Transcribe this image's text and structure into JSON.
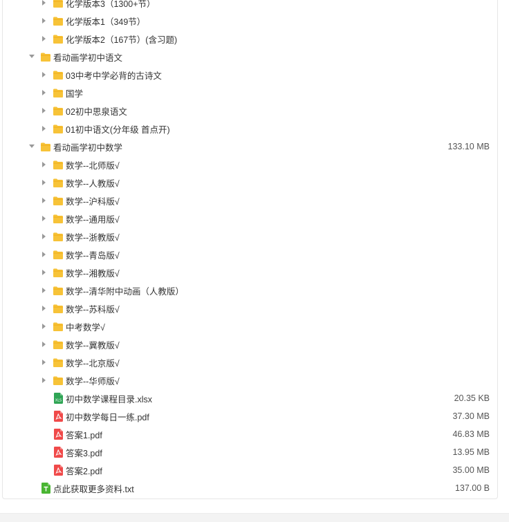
{
  "rows": [
    {
      "level": 1,
      "type": "folder",
      "state": "collapsed",
      "name": "化学版本3（1300+节）",
      "size": ""
    },
    {
      "level": 1,
      "type": "folder",
      "state": "collapsed",
      "name": "化学版本1（349节）",
      "size": ""
    },
    {
      "level": 1,
      "type": "folder",
      "state": "collapsed",
      "name": "化学版本2（167节）(含习题)",
      "size": ""
    },
    {
      "level": 0,
      "type": "folder",
      "state": "expanded",
      "name": "看动画学初中语文",
      "size": ""
    },
    {
      "level": 1,
      "type": "folder",
      "state": "collapsed",
      "name": "03中考中学必背的古诗文",
      "size": ""
    },
    {
      "level": 1,
      "type": "folder",
      "state": "collapsed",
      "name": "国学",
      "size": ""
    },
    {
      "level": 1,
      "type": "folder",
      "state": "collapsed",
      "name": "02初中思泉语文",
      "size": ""
    },
    {
      "level": 1,
      "type": "folder",
      "state": "collapsed",
      "name": "01初中语文(分年级 首点开)",
      "size": ""
    },
    {
      "level": 0,
      "type": "folder",
      "state": "expanded",
      "name": "看动画学初中数学",
      "size": "133.10 MB"
    },
    {
      "level": 1,
      "type": "folder",
      "state": "collapsed",
      "name": "数学--北师版√",
      "size": ""
    },
    {
      "level": 1,
      "type": "folder",
      "state": "collapsed",
      "name": "数学--人教版√",
      "size": ""
    },
    {
      "level": 1,
      "type": "folder",
      "state": "collapsed",
      "name": "数学--沪科版√",
      "size": ""
    },
    {
      "level": 1,
      "type": "folder",
      "state": "collapsed",
      "name": "数学--通用版√",
      "size": ""
    },
    {
      "level": 1,
      "type": "folder",
      "state": "collapsed",
      "name": "数学--浙教版√",
      "size": ""
    },
    {
      "level": 1,
      "type": "folder",
      "state": "collapsed",
      "name": "数学--青岛版√",
      "size": ""
    },
    {
      "level": 1,
      "type": "folder",
      "state": "collapsed",
      "name": "数学--湘教版√",
      "size": ""
    },
    {
      "level": 1,
      "type": "folder",
      "state": "collapsed",
      "name": "数学--清华附中动画（人教版）",
      "size": ""
    },
    {
      "level": 1,
      "type": "folder",
      "state": "collapsed",
      "name": "数学--苏科版√",
      "size": ""
    },
    {
      "level": 1,
      "type": "folder",
      "state": "collapsed",
      "name": "中考数学√",
      "size": ""
    },
    {
      "level": 1,
      "type": "folder",
      "state": "collapsed",
      "name": "数学--冀教版√",
      "size": ""
    },
    {
      "level": 1,
      "type": "folder",
      "state": "collapsed",
      "name": "数学--北京版√",
      "size": ""
    },
    {
      "level": 1,
      "type": "folder",
      "state": "collapsed",
      "name": "数学--华师版√",
      "size": ""
    },
    {
      "level": 1,
      "type": "xlsx",
      "state": "",
      "name": "初中数学课程目录.xlsx",
      "size": "20.35 KB"
    },
    {
      "level": 1,
      "type": "pdf",
      "state": "",
      "name": "初中数学每日一练.pdf",
      "size": "37.30 MB"
    },
    {
      "level": 1,
      "type": "pdf",
      "state": "",
      "name": "答案1.pdf",
      "size": "46.83 MB"
    },
    {
      "level": 1,
      "type": "pdf",
      "state": "",
      "name": "答案3.pdf",
      "size": "13.95 MB"
    },
    {
      "level": 1,
      "type": "pdf",
      "state": "",
      "name": "答案2.pdf",
      "size": "35.00 MB"
    },
    {
      "level": 0,
      "type": "txt",
      "state": "",
      "name": "点此获取更多资料.txt",
      "size": "137.00 B"
    }
  ],
  "colors": {
    "folder": "#f7c338",
    "folder_tab": "#f2b01e",
    "xlsx": "#2fa555",
    "pdf": "#f04a4a",
    "txt": "#49b532",
    "arrow": "#999999"
  }
}
